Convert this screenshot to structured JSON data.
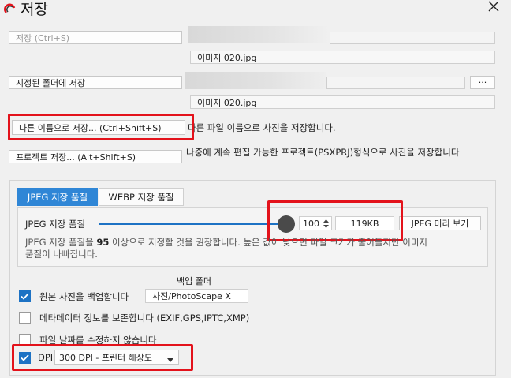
{
  "window": {
    "title": "저장"
  },
  "rows": [
    {
      "button": "저장  (Ctrl+S)",
      "filename": "이미지 020.jpg"
    },
    {
      "button": "지정된 폴더에 저장",
      "folder_button": "···",
      "filename": "이미지 020.jpg"
    },
    {
      "button": "다른 이름으로 저장...  (Ctrl+Shift+S)",
      "description": "다른 파일 이름으로 사진을 저장합니다."
    },
    {
      "button": "프로젝트 저장...  (Alt+Shift+S)",
      "description": "나중에 계속 편집 가능한 프로젝트(PSXPRJ)형식으로 사진을 저장합니다"
    }
  ],
  "quality": {
    "tabs": [
      "JPEG 저장 품질",
      "WEBP 저장 품질"
    ],
    "label": "JPEG 저장 품질",
    "value": "100",
    "value_number": 100,
    "file_size": "119KB",
    "preview_button": "JPEG 미리 보기",
    "hint_line1_before": "JPEG 저장 품질을 ",
    "hint_bold": "95",
    "hint_line1_after": " 이상으로 지정할 것을 권장합니다. 높은 값이 낮으면 파일 크기가 줄어들지만 이미지",
    "hint_line2": "품질이 나빠집니다."
  },
  "options": {
    "backup_folder_label": "백업 폴더",
    "backup": {
      "label": "원본 사진을 백업합니다",
      "checked": true,
      "folder": "사진/PhotoScape X"
    },
    "metadata": {
      "label": "메타데이터 정보를 보존합니다 (EXIF,GPS,IPTC,XMP)",
      "checked": false
    },
    "keep_date": {
      "label": "파일 날짜를 수정하지 않습니다",
      "checked": false
    },
    "dpi": {
      "label": "DPI",
      "checked": true,
      "selected": "300 DPI - 프린터 해상도"
    }
  },
  "colors": {
    "accent": "#1d72c4",
    "highlight": "#e3121b",
    "slider_knob": "#4a4a4a"
  }
}
